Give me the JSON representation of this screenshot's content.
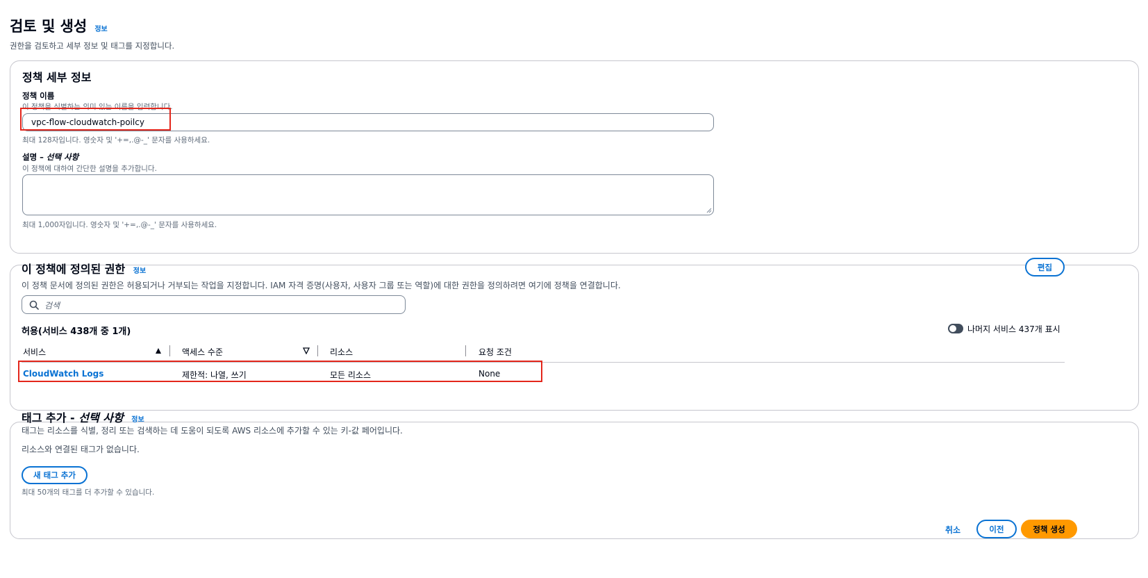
{
  "header": {
    "title": "검토 및 생성",
    "info_label": "정보",
    "description": "권한을 검토하고 세부 정보 및 태그를 지정합니다."
  },
  "policy_details": {
    "title": "정책 세부 정보",
    "name_label": "정책 이름",
    "name_hint": "이 정책을 식별하는 의미 있는 이름을 입력합니다.",
    "name_value": "vpc-flow-cloudwatch-poilcy",
    "name_constraint": "최대 128자입니다. 영숫자 및 '+=,.@-_' 문자를 사용하세요.",
    "desc_label_main": "설명 – ",
    "desc_label_optional": "선택 사항",
    "desc_hint": "이 정책에 대하여 간단한 설명을 추가합니다.",
    "desc_value": "",
    "desc_constraint": "최대 1,000자입니다. 영숫자 및 '+=,.@-_' 문자를 사용하세요."
  },
  "permissions": {
    "title": "이 정책에 정의된 권한",
    "info_label": "정보",
    "edit_label": "편집",
    "description": "이 정책 문서에 정의된 권한은 허용되거나 거부되는 작업을 지정합니다. IAM 자격 증명(사용자, 사용자 그룹 또는 역할)에 대한 권한을 정의하려면 여기에 정책을 연결합니다.",
    "search_placeholder": "검색",
    "allow_heading": "허용(서비스 438개 중 1개)",
    "toggle_label": "나머지 서비스 437개 표시",
    "toggle_on": false,
    "columns": [
      "서비스",
      "액세스 수준",
      "리소스",
      "요청 조건"
    ],
    "rows": [
      {
        "service": "CloudWatch Logs",
        "access_level": "제한적: 나열, 쓰기",
        "resource": "모든 리소스",
        "condition": "None"
      }
    ]
  },
  "tags": {
    "title_main": "태그 추가 - ",
    "title_optional": "선택 사항",
    "info_label": "정보",
    "description": "태그는 리소스를 식별, 정리 또는 검색하는 데 도움이 되도록 AWS 리소스에 추가할 수 있는 키-값 페어입니다.",
    "empty_text": "리소스와 연결된 태그가 없습니다.",
    "add_label": "새 태그 추가",
    "limit_text": "최대 50개의 태그를 더 추가할 수 있습니다."
  },
  "footer": {
    "cancel_label": "취소",
    "previous_label": "이전",
    "create_label": "정책 생성"
  },
  "colors": {
    "link": "#0972d3",
    "primary_button": "#ff9900",
    "highlight": "#e3261b",
    "border": "#c6c6cd"
  }
}
